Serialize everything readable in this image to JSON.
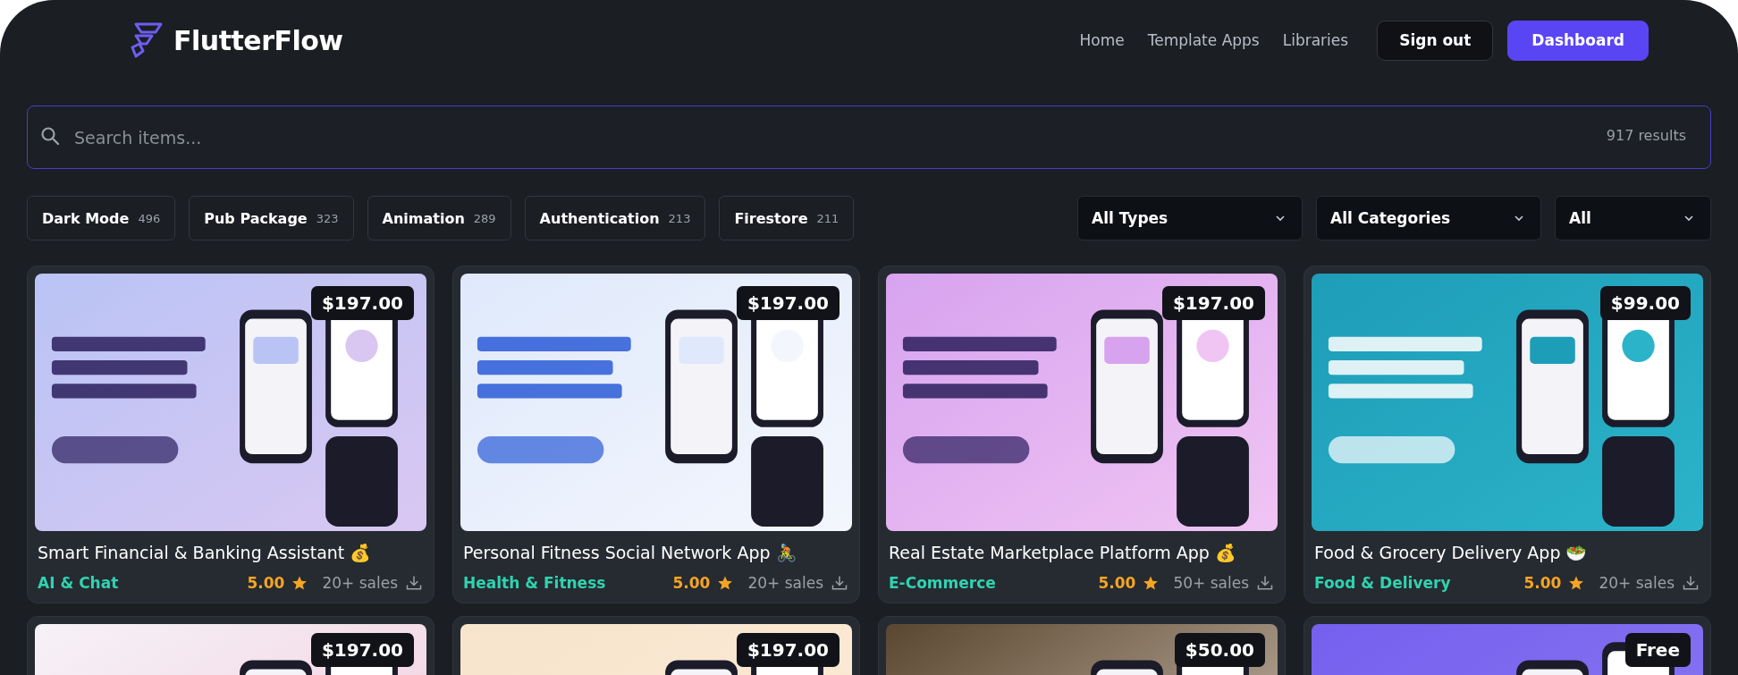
{
  "brand": {
    "name": "FlutterFlow"
  },
  "nav": {
    "links": [
      "Home",
      "Template Apps",
      "Libraries"
    ],
    "sign_out": "Sign out",
    "dashboard": "Dashboard"
  },
  "search": {
    "placeholder": "Search items...",
    "results": "917 results"
  },
  "chips": [
    {
      "label": "Dark Mode",
      "count": "496"
    },
    {
      "label": "Pub Package",
      "count": "323"
    },
    {
      "label": "Animation",
      "count": "289"
    },
    {
      "label": "Authentication",
      "count": "213"
    },
    {
      "label": "Firestore",
      "count": "211"
    }
  ],
  "filters": [
    "All Types",
    "All Categories",
    "All"
  ],
  "cards": [
    {
      "price": "$197.00",
      "title": "Smart Financial & Banking Assistant 💰",
      "category": "AI & Chat",
      "rating": "5.00",
      "sales": "20+ sales"
    },
    {
      "price": "$197.00",
      "title": "Personal Fitness Social Network App 🚴",
      "category": "Health & Fitness",
      "rating": "5.00",
      "sales": "20+ sales"
    },
    {
      "price": "$197.00",
      "title": "Real Estate Marketplace Platform App 💰",
      "category": "E-Commerce",
      "rating": "5.00",
      "sales": "50+ sales"
    },
    {
      "price": "$99.00",
      "title": "Food & Grocery Delivery App 🥗",
      "category": "Food & Delivery",
      "rating": "5.00",
      "sales": "20+ sales"
    },
    {
      "price": "$197.00"
    },
    {
      "price": "$197.00"
    },
    {
      "price": "$50.00"
    },
    {
      "price": "Free"
    }
  ]
}
